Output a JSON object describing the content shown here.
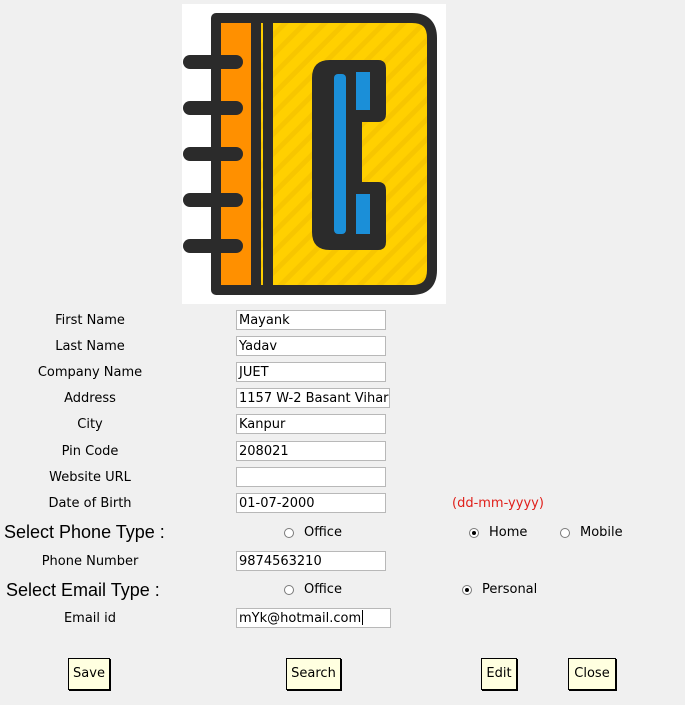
{
  "form": {
    "first_name": {
      "label": "First Name",
      "value": "Mayank"
    },
    "last_name": {
      "label": "Last Name",
      "value": "Yadav"
    },
    "company": {
      "label": "Company Name",
      "value": "JUET"
    },
    "address": {
      "label": "Address",
      "value": "1157 W-2 Basant Vihar"
    },
    "city": {
      "label": "City",
      "value": "Kanpur"
    },
    "pin": {
      "label": "Pin Code",
      "value": "208021"
    },
    "website": {
      "label": "Website URL",
      "value": ""
    },
    "dob": {
      "label": "Date of Birth",
      "value": "01-07-2000",
      "hint": "(dd-mm-yyyy)"
    },
    "phone_type": {
      "label": "Select Phone Type :",
      "options": [
        "Office",
        "Home",
        "Mobile"
      ],
      "selected": "Home"
    },
    "phone": {
      "label": "Phone Number",
      "value": "9874563210"
    },
    "email_type": {
      "label": "Select Email Type :",
      "options": [
        "Office",
        "Personal"
      ],
      "selected": "Personal"
    },
    "email": {
      "label": "Email id",
      "value": "mYk@hotmail.com"
    }
  },
  "buttons": {
    "save": "Save",
    "search": "Search",
    "edit": "Edit",
    "close": "Close"
  },
  "colors": {
    "hint": "#e0201b",
    "button_bg": "#ffffe0",
    "logo_yellow": "#ffd000",
    "logo_orange": "#ff9000",
    "logo_blue": "#1b8fd8"
  },
  "icons": {
    "logo": "address-book-phone-icon"
  }
}
